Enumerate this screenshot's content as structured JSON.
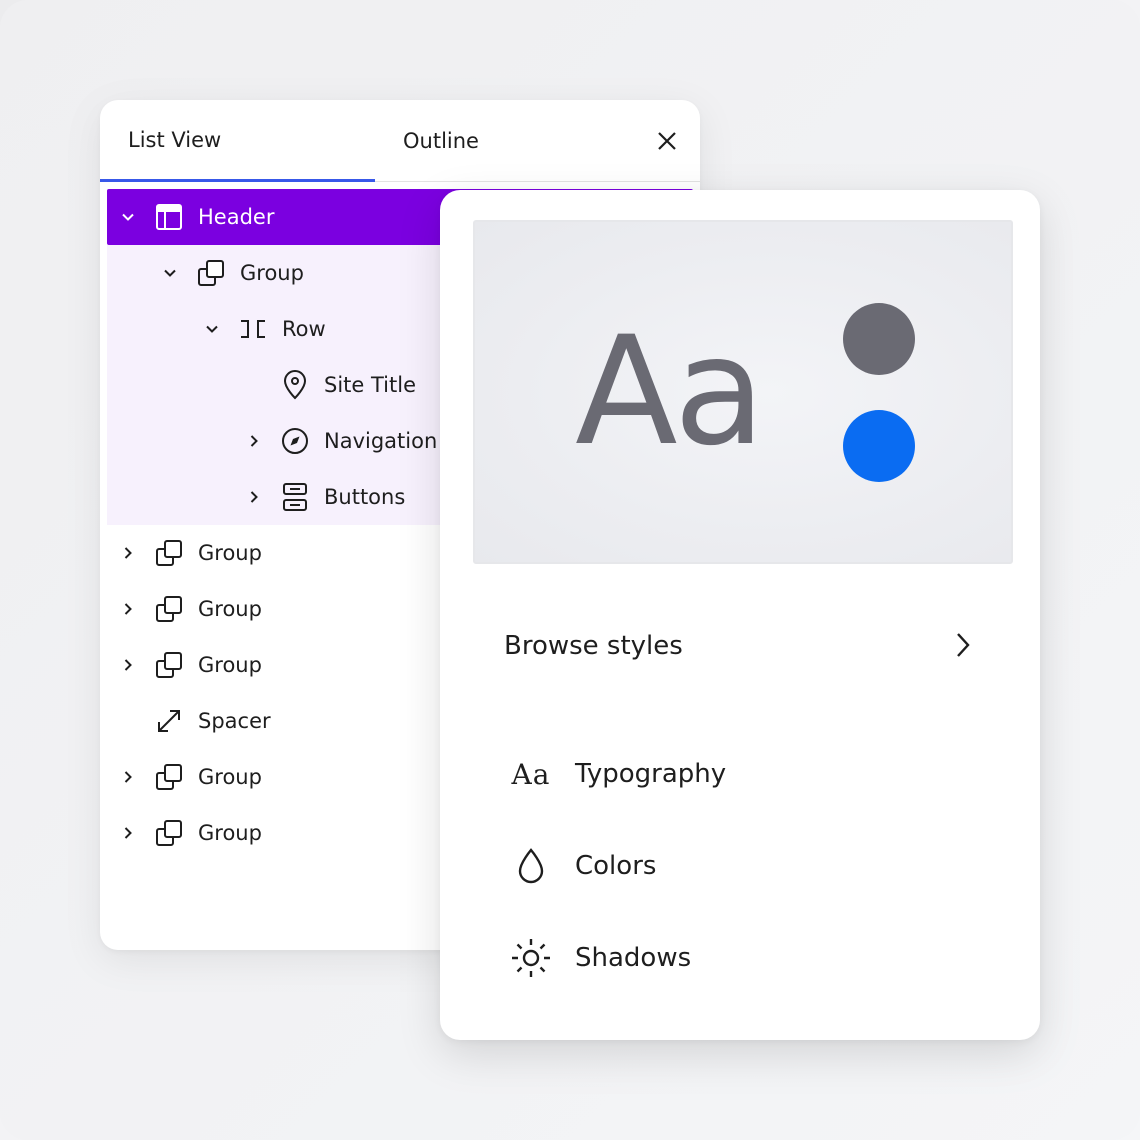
{
  "list_view": {
    "tabs": [
      {
        "label": "List View",
        "active": true
      },
      {
        "label": "Outline",
        "active": false
      }
    ],
    "close_icon": "close-icon",
    "accent_color": "#3858e9",
    "selected_color": "#7b00e0",
    "items": [
      {
        "label": "Header",
        "icon": "template-part-header-icon",
        "expanded": true,
        "selected": true
      },
      {
        "label": "Group",
        "icon": "group-icon",
        "expanded": true
      },
      {
        "label": "Row",
        "icon": "row-icon",
        "expanded": true
      },
      {
        "label": "Site Title",
        "icon": "map-marker-icon"
      },
      {
        "label": "Navigation",
        "icon": "navigation-compass-icon",
        "expanded": false
      },
      {
        "label": "Buttons",
        "icon": "buttons-icon",
        "expanded": false
      },
      {
        "label": "Group",
        "icon": "group-icon",
        "expanded": false
      },
      {
        "label": "Group",
        "icon": "group-icon",
        "expanded": false
      },
      {
        "label": "Group",
        "icon": "group-icon",
        "expanded": false
      },
      {
        "label": "Spacer",
        "icon": "resize-corner-icon"
      },
      {
        "label": "Group",
        "icon": "group-icon",
        "expanded": false
      },
      {
        "label": "Group",
        "icon": "group-icon",
        "expanded": false
      }
    ]
  },
  "styles": {
    "preview": {
      "sample_text": "Aa",
      "text_color": "#6a6a73",
      "palette": [
        "#6a6a73",
        "#0a6cf2"
      ]
    },
    "browse_label": "Browse styles",
    "menu": [
      {
        "label": "Typography",
        "icon": "typography-icon",
        "glyph": "Aa"
      },
      {
        "label": "Colors",
        "icon": "droplet-icon"
      },
      {
        "label": "Shadows",
        "icon": "shadow-sun-icon"
      }
    ]
  }
}
